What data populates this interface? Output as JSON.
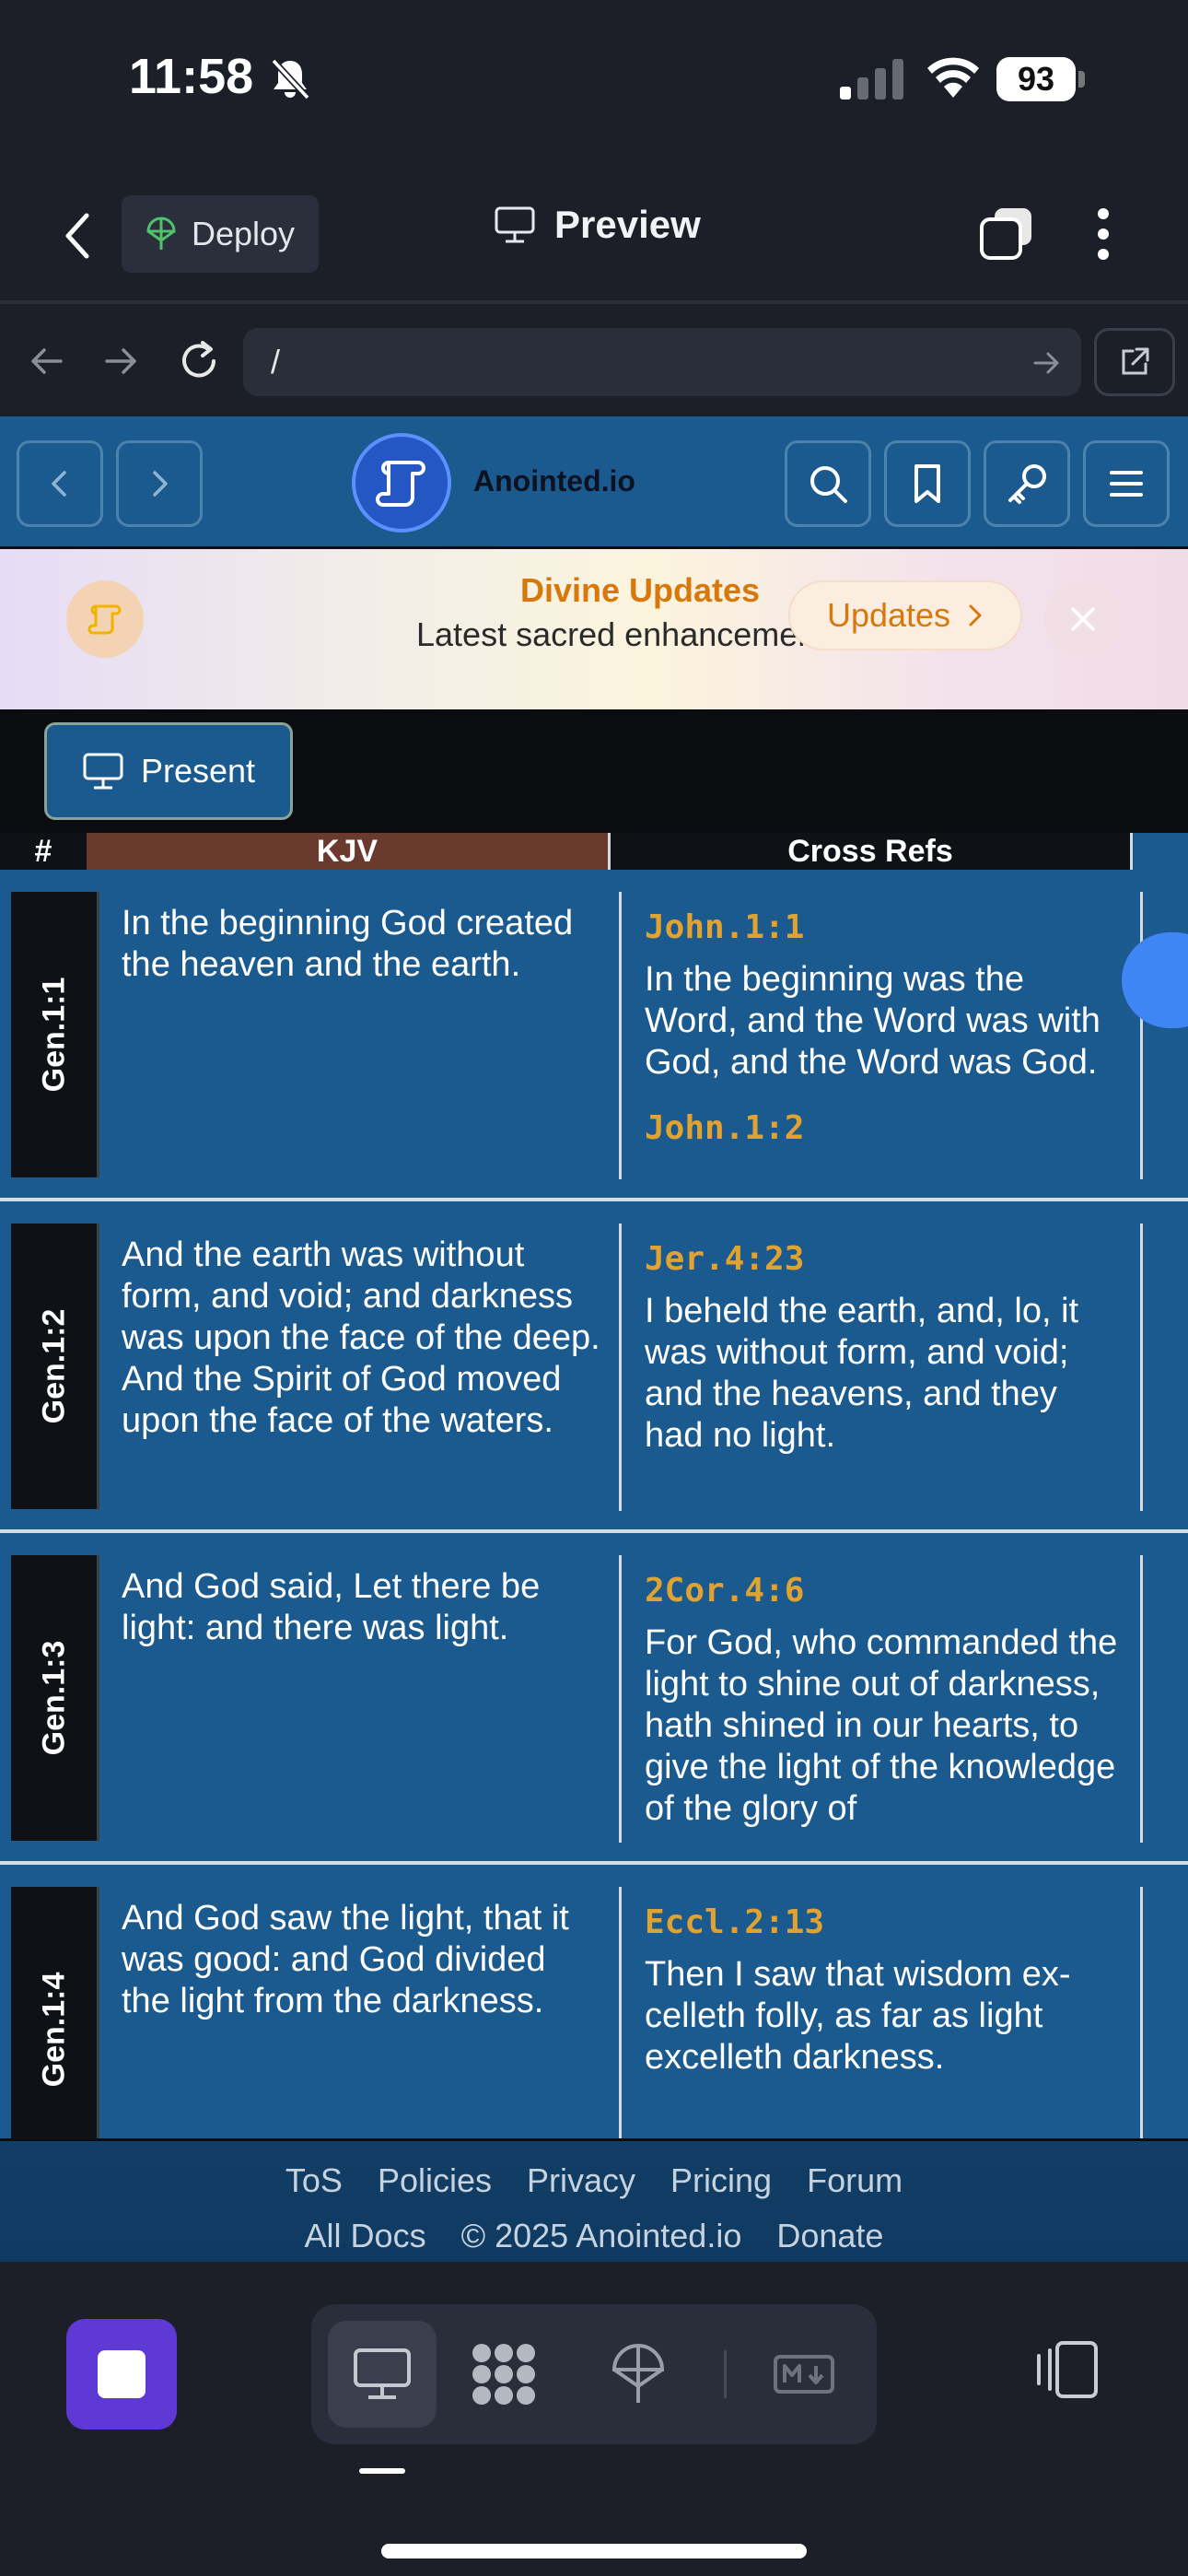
{
  "status_bar": {
    "time": "11:58",
    "battery": "93"
  },
  "app_bar": {
    "deploy_label": "Deploy",
    "preview_label": "Preview"
  },
  "url_bar": {
    "url": "/"
  },
  "site_header": {
    "name": "Anointed.io"
  },
  "banner": {
    "title": "Divine Updates",
    "subtitle": "Latest sacred enhancements",
    "button_label": "Updates"
  },
  "present_label": "Present",
  "table": {
    "headers": {
      "num": "#",
      "kjv": "KJV",
      "xref": "Cross Refs"
    },
    "rows": [
      {
        "ref": "Gen.1:1",
        "kjv": "In the beginning God created the heaven and the earth.",
        "xrefs": [
          {
            "ref": "John.1:1",
            "text": "In the beginning was the Word, and the Word was with God, and the Word was God."
          },
          {
            "ref": "John.1:2",
            "text": ""
          }
        ]
      },
      {
        "ref": "Gen.1:2",
        "kjv": "And the earth was without form, and void; and darkness was upon the face of the deep. And the Spirit of God moved upon the face of the waters.",
        "xrefs": [
          {
            "ref": "Jer.4:23",
            "text": "I beheld the earth, and, lo, it was without form, and void; and the heavens, and they had no light."
          }
        ]
      },
      {
        "ref": "Gen.1:3",
        "kjv": "And God said, Let there be light: and there was light.",
        "xrefs": [
          {
            "ref": "2Cor.4:6",
            "text": "For God, who commanded the light to shine out of dark­ness, hath shined in our hearts, to give the light of the knowledge of the glory of"
          }
        ]
      },
      {
        "ref": "Gen.1:4",
        "kjv": "And God saw the light, that it was good: and God divided the light from the darkness.",
        "xrefs": [
          {
            "ref": "Eccl.2:13",
            "text": "Then I saw that wisdom ex­celleth folly, as far as light excelleth darkness."
          }
        ]
      }
    ]
  },
  "footer": {
    "row1": [
      "ToS",
      "Policies",
      "Privacy",
      "Pricing",
      "Forum"
    ],
    "row2": [
      "All Docs",
      "© 2025 Anointed.io",
      "Donate"
    ]
  },
  "colors": {
    "site_blue": "#1b5a8f",
    "accent_orange": "#d8780b",
    "xref_gold": "#e0a231",
    "kjv_header": "#6b3a2e",
    "stop_purple": "#5e39d6"
  }
}
